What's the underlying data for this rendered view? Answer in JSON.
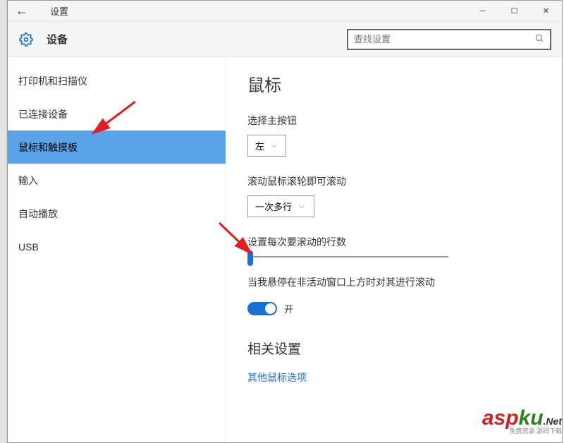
{
  "window": {
    "title": "设置"
  },
  "header": {
    "title": "设备",
    "search_placeholder": "查找设置"
  },
  "sidebar": {
    "items": [
      {
        "label": "打印机和扫描仪"
      },
      {
        "label": "已连接设备"
      },
      {
        "label": "鼠标和触摸板"
      },
      {
        "label": "输入"
      },
      {
        "label": "自动播放"
      },
      {
        "label": "USB"
      }
    ],
    "active_index": 2
  },
  "main": {
    "title": "鼠标",
    "primary_button": {
      "label": "选择主按钮",
      "value": "左"
    },
    "scroll_wheel": {
      "label": "滚动鼠标滚轮即可滚动",
      "value": "一次多行"
    },
    "scroll_lines": {
      "label": "设置每次要滚动的行数",
      "value": 1,
      "min": 1,
      "max": 100
    },
    "inactive_hover": {
      "label": "当我悬停在非活动窗口上方时对其进行滚动",
      "state": "开",
      "on": true
    },
    "related": {
      "title": "相关设置",
      "link": "其他鼠标选项"
    }
  },
  "watermark": {
    "brand_a": "asp",
    "brand_b": "ku",
    "suffix": ".Net",
    "sub": "免费资源 源码下载"
  }
}
